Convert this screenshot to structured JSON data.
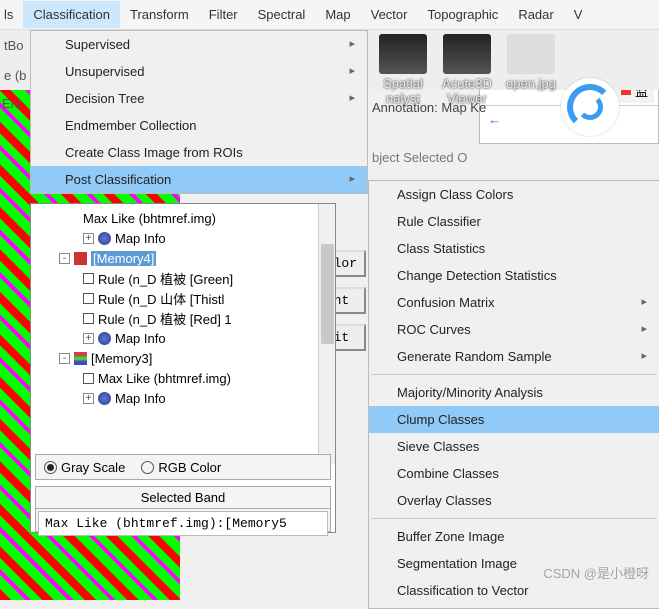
{
  "menubar": {
    "items": [
      "ls",
      "Classification",
      "Transform",
      "Filter",
      "Spectral",
      "Map",
      "Vector",
      "Topographic",
      "Radar",
      "V"
    ],
    "active_index": 1
  },
  "secondary": {
    "row1": "tBo",
    "row2": "e (b",
    "row3": "Enl"
  },
  "thumbs": {
    "spatial": "Spatial\nnalyst",
    "acute": "Acute3D\nViewer",
    "open": "open.jpg"
  },
  "browser_tab": "监",
  "annotation": "Annotation: Map Ke",
  "annotation2": "bject   Selected   O",
  "dropdown1": {
    "items": [
      {
        "label": "Supervised",
        "sub": true
      },
      {
        "label": "Unsupervised",
        "sub": true
      },
      {
        "label": "Decision Tree",
        "sub": true
      },
      {
        "label": "Endmember Collection",
        "sub": false
      },
      {
        "label": "Create Class Image from ROIs",
        "sub": false
      },
      {
        "label": "Post Classification",
        "sub": true,
        "active": true
      }
    ]
  },
  "dropdown2": {
    "groups": [
      [
        {
          "label": "Assign Class Colors"
        },
        {
          "label": "Rule Classifier"
        },
        {
          "label": "Class Statistics"
        },
        {
          "label": "Change Detection Statistics"
        },
        {
          "label": "Confusion Matrix",
          "sub": true
        },
        {
          "label": "ROC Curves",
          "sub": true
        },
        {
          "label": "Generate Random Sample",
          "sub": true
        }
      ],
      [
        {
          "label": "Majority/Minority Analysis"
        },
        {
          "label": "Clump Classes",
          "active": true
        },
        {
          "label": "Sieve Classes"
        },
        {
          "label": "Combine Classes"
        },
        {
          "label": "Overlay Classes"
        }
      ],
      [
        {
          "label": "Buffer Zone Image"
        },
        {
          "label": "Segmentation Image"
        },
        {
          "label": "Classification to Vector"
        }
      ]
    ]
  },
  "tree": {
    "rows": [
      {
        "indent": 48,
        "text": "Max Like (bhtmref.img)"
      },
      {
        "indent": 48,
        "exp": "+",
        "icon": "globe",
        "text": "Map Info"
      },
      {
        "indent": 24,
        "exp": "-",
        "icon": "stackred",
        "sel": true,
        "text": "[Memory4]"
      },
      {
        "indent": 48,
        "chk": true,
        "text": "Rule (n_D 植被 [Green]"
      },
      {
        "indent": 48,
        "chk": true,
        "text": "Rule (n_D 山体 [Thistl"
      },
      {
        "indent": 48,
        "chk": true,
        "text": "Rule (n_D 植被 [Red] 1"
      },
      {
        "indent": 48,
        "exp": "+",
        "icon": "globe",
        "text": "Map Info"
      },
      {
        "indent": 24,
        "exp": "-",
        "icon": "stack",
        "text": "[Memory3]"
      },
      {
        "indent": 48,
        "chk": true,
        "text": "Max Like (bhtmref.img)"
      },
      {
        "indent": 48,
        "exp": "+",
        "icon": "globe",
        "text": "Map Info"
      }
    ]
  },
  "side_buttons": [
    "Color",
    "Font",
    "Edit"
  ],
  "radios": {
    "gray": "Gray Scale",
    "rgb": "RGB Color"
  },
  "selected_band": {
    "header": "Selected Band",
    "value": "Max Like (bhtmref.img):[Memory5"
  },
  "watermark": "CSDN @是小橙呀"
}
